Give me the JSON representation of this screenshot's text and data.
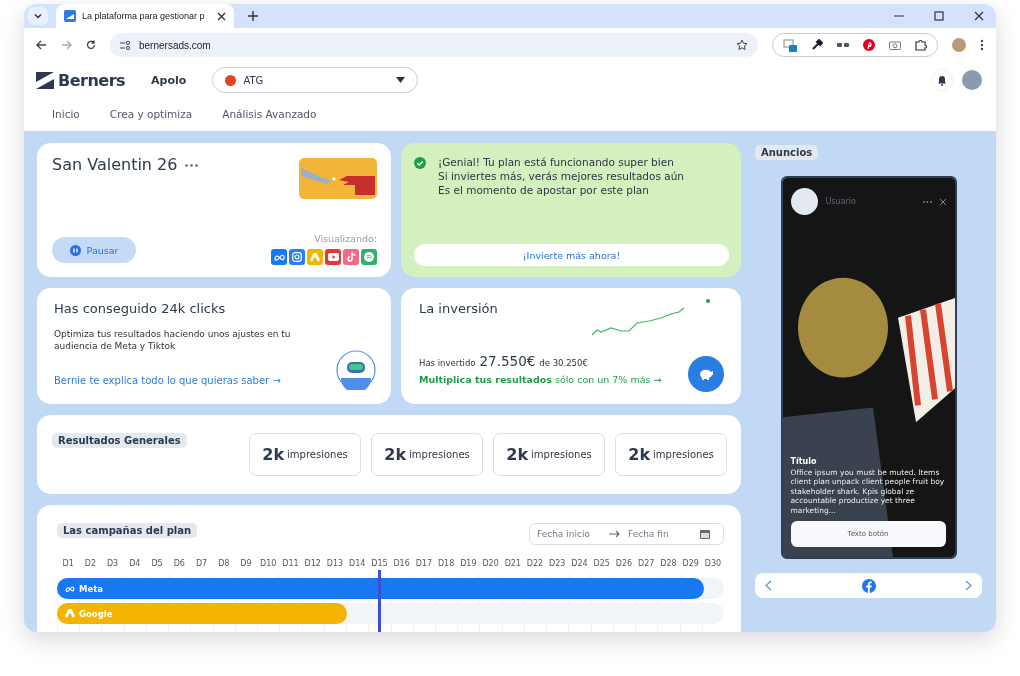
{
  "browser": {
    "tab_title": "La plataforma para gestionar p",
    "url": "bernersads.com"
  },
  "header": {
    "logo": "Berners",
    "workspace": "Apolo",
    "account": {
      "label": "ATG",
      "color": "#e8451e"
    }
  },
  "nav": [
    {
      "label": "Inicio",
      "selected": false
    },
    {
      "label": "Crea y optimiza",
      "selected": false
    },
    {
      "label": "Análisis Avanzado",
      "selected": false
    }
  ],
  "campaign_card": {
    "title": "San Valentin 26",
    "pause_button": "Pausar",
    "viewing_label": "Visualizando:",
    "platforms": [
      {
        "kind": "meta",
        "color": "#1877f2"
      },
      {
        "kind": "instagram",
        "color": "#2d7ff0"
      },
      {
        "kind": "google",
        "color": "#f4b400"
      },
      {
        "kind": "youtube",
        "color": "#e53935"
      },
      {
        "kind": "tiktok",
        "color": "#f06b8a"
      },
      {
        "kind": "spotify",
        "color": "#2db36b"
      }
    ]
  },
  "success_card": {
    "lines": [
      "¡Genial! Tu plan está funcionando super bien",
      "Si inviertes más, verás mejores resultados aún",
      "Es el momento de apostar por este plan"
    ],
    "button": "¡Invierte más ahora!"
  },
  "clicks_card": {
    "title": "Has conseguido 24k clicks",
    "text": "Optimiza tus resultados haciendo unos ajustes en tu audiencia de Meta y Tiktok",
    "link": "Bernie te explica todo lo que quieras saber →"
  },
  "investment_card": {
    "title": "La inversión",
    "spent_label": "Has invertido",
    "spent": "27.550€",
    "total": "de 30.250€",
    "cta_bold": "Multiplica tus resultados",
    "cta_rest": "sólo con un 7% más →"
  },
  "results": {
    "title": "Resultados Generales",
    "stats": [
      {
        "value": "2k",
        "label": "impresiones"
      },
      {
        "value": "2k",
        "label": "impresiones"
      },
      {
        "value": "2k",
        "label": "impresiones"
      },
      {
        "value": "2k",
        "label": "impresiones"
      }
    ]
  },
  "campaigns": {
    "title": "Las campañas del plan",
    "date_start": {
      "placeholder": "Fecha inicio"
    },
    "date_end": {
      "placeholder": "Fecha fin"
    },
    "days": [
      "D1",
      "D2",
      "D3",
      "D4",
      "D5",
      "D6",
      "D7",
      "D8",
      "D9",
      "D10",
      "D11",
      "D12",
      "D13",
      "D14",
      "D15",
      "D16",
      "D17",
      "D18",
      "D19",
      "D20",
      "D21",
      "D22",
      "D23",
      "D24",
      "D25",
      "D26",
      "D27",
      "D28",
      "D29",
      "D30"
    ],
    "today_marker": {
      "level": 0.483
    },
    "bars": [
      {
        "kind": "meta",
        "label": "Meta",
        "color": "#1877f2",
        "level": 0.97
      },
      {
        "kind": "google",
        "label": "Google",
        "color": "#f4b400",
        "level": 0.435
      }
    ]
  },
  "ads": {
    "title": "Anuncios",
    "preview": {
      "user": "Usuario",
      "headline": "Título",
      "body": "Office ipsum you must be muted. Items client plan unpack client people fruit boy stakeholder shark. Kpis global ze accountable productize yet three marketing...",
      "button": "Texto botón"
    }
  }
}
